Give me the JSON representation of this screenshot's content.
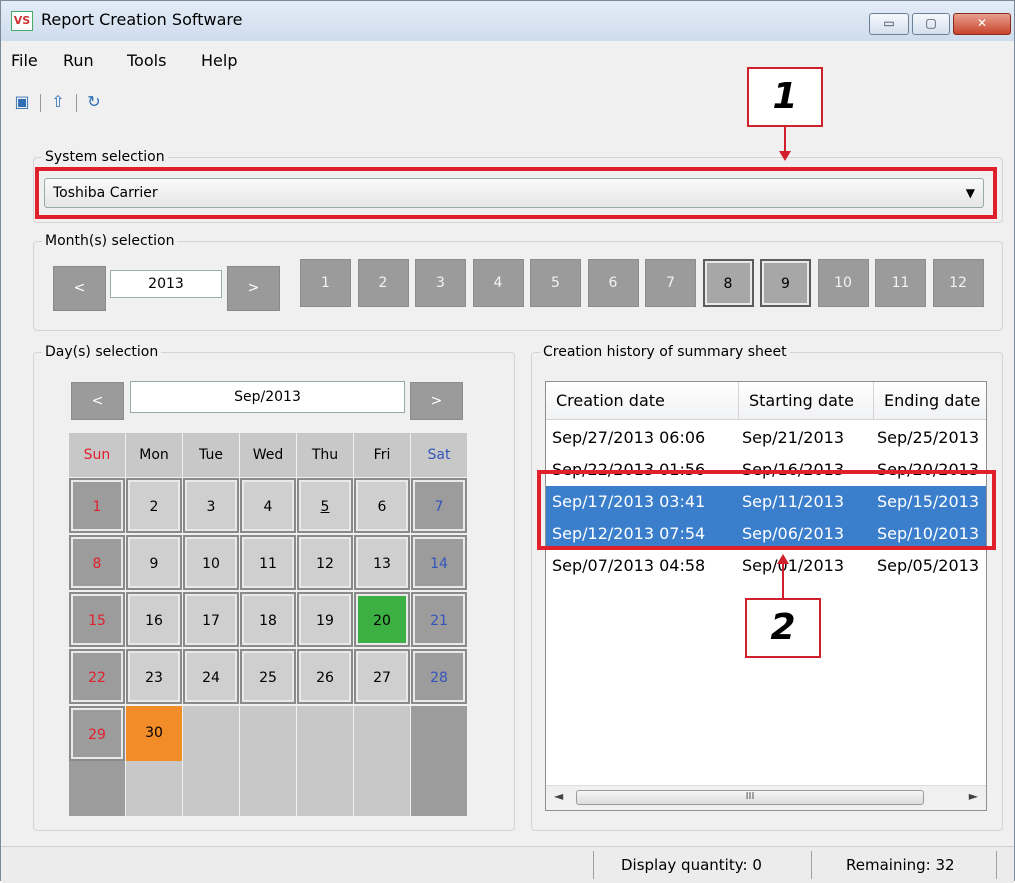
{
  "window": {
    "app_icon": "VS",
    "title": "Report Creation Software",
    "minimize_glyph": "▭",
    "maximize_glyph": "▢",
    "close_glyph": "✕"
  },
  "menu": [
    "File",
    "Run",
    "Tools",
    "Help"
  ],
  "toolbar": {
    "icons": [
      "report-icon",
      "export-icon",
      "refresh-icon"
    ],
    "glyphs": [
      "▣",
      "⇧",
      "↻"
    ]
  },
  "system_selection": {
    "legend": "System selection",
    "value": "Toshiba Carrier",
    "arrow": "▼"
  },
  "month_selection": {
    "legend": "Month(s) selection",
    "prev": "<",
    "next": ">",
    "year": "2013",
    "months": [
      "1",
      "2",
      "3",
      "4",
      "5",
      "6",
      "7",
      "8",
      "9",
      "10",
      "11",
      "12"
    ],
    "selected": [
      "8",
      "9"
    ]
  },
  "day_selection": {
    "legend": "Day(s) selection",
    "prev": "<",
    "next": ">",
    "month_label": "Sep/2013",
    "weekdays": [
      "Sun",
      "Mon",
      "Tue",
      "Wed",
      "Thu",
      "Fri",
      "Sat"
    ],
    "weekday_colors": [
      "#e0202b",
      "#000000",
      "#000000",
      "#000000",
      "#000000",
      "#000000",
      "#3355bb"
    ],
    "weeks": [
      [
        "1",
        "2",
        "3",
        "4",
        "5",
        "6",
        "7"
      ],
      [
        "8",
        "9",
        "10",
        "11",
        "12",
        "13",
        "14"
      ],
      [
        "15",
        "16",
        "17",
        "18",
        "19",
        "20",
        "21"
      ],
      [
        "22",
        "23",
        "24",
        "25",
        "26",
        "27",
        "28"
      ],
      [
        "29",
        "30",
        "",
        "",
        "",
        "",
        ""
      ],
      [
        "",
        "",
        "",
        "",
        "",
        "",
        ""
      ]
    ],
    "today": "20",
    "today_color": "#3cb043",
    "highlight": "30",
    "highlight_color": "#f28c28",
    "underlined_day": "5"
  },
  "history": {
    "legend": "Creation history of summary sheet",
    "columns": [
      "Creation date",
      "Starting date",
      "Ending date"
    ],
    "rows": [
      [
        "Sep/27/2013 06:06",
        "Sep/21/2013",
        "Sep/25/2013"
      ],
      [
        "Sep/22/2013 01:56",
        "Sep/16/2013",
        "Sep/20/2013"
      ],
      [
        "Sep/17/2013 03:41",
        "Sep/11/2013",
        "Sep/15/2013"
      ],
      [
        "Sep/12/2013 07:54",
        "Sep/06/2013",
        "Sep/10/2013"
      ],
      [
        "Sep/07/2013 04:58",
        "Sep/01/2013",
        "Sep/05/2013"
      ]
    ],
    "selected_rows": [
      2,
      3
    ],
    "scroll_left": "◄",
    "scroll_right": "►",
    "scroll_grip": "III"
  },
  "status": {
    "display_quantity": "Display quantity: 0",
    "remaining": "Remaining: 32"
  },
  "callouts": [
    "1",
    "2"
  ]
}
